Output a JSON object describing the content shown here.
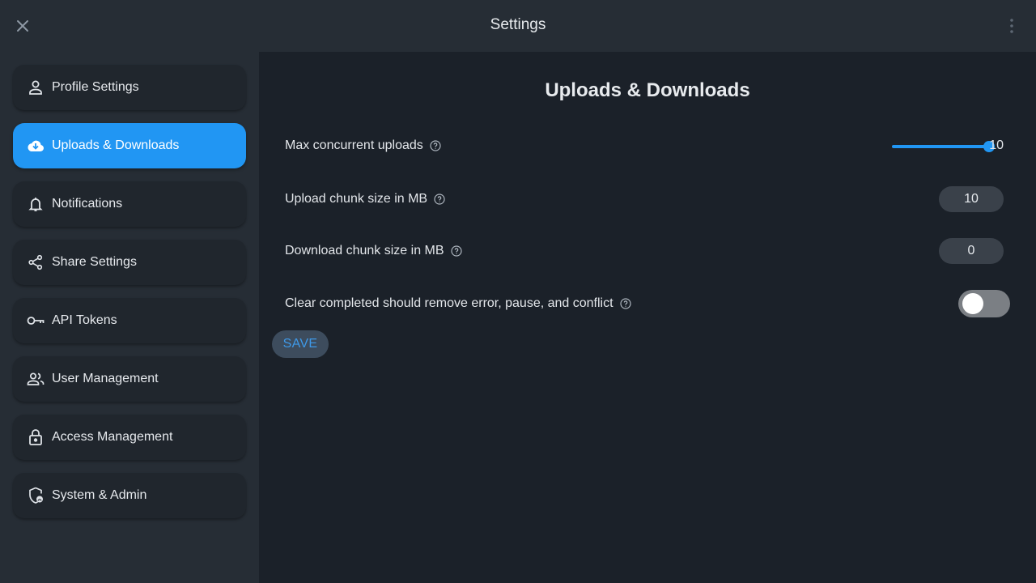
{
  "header": {
    "title": "Settings",
    "close_icon": "close-icon",
    "menu_icon": "more-vert-icon"
  },
  "sidebar": {
    "items": [
      {
        "label": "Profile Settings",
        "icon": "person-icon",
        "active": false
      },
      {
        "label": "Uploads & Downloads",
        "icon": "cloud-download-icon",
        "active": true
      },
      {
        "label": "Notifications",
        "icon": "bell-icon",
        "active": false
      },
      {
        "label": "Share Settings",
        "icon": "share-icon",
        "active": false
      },
      {
        "label": "API Tokens",
        "icon": "key-icon",
        "active": false
      },
      {
        "label": "User Management",
        "icon": "users-icon",
        "active": false
      },
      {
        "label": "Access Management",
        "icon": "lock-icon",
        "active": false
      },
      {
        "label": "System & Admin",
        "icon": "shield-icon",
        "active": false
      }
    ]
  },
  "main": {
    "title": "Uploads & Downloads",
    "max_uploads": {
      "label": "Max concurrent uploads",
      "value": "10",
      "slider_fraction": 1.0
    },
    "upload_chunk": {
      "label": "Upload chunk size in MB",
      "value": "10"
    },
    "download_chunk": {
      "label": "Download chunk size in MB",
      "value": "0"
    },
    "clear_completed": {
      "label": "Clear completed should remove error, pause, and conflict",
      "enabled": false
    },
    "save_label": "SAVE"
  },
  "colors": {
    "accent": "#2196f3",
    "background": "#1b2129",
    "sidebar": "#262d35"
  }
}
